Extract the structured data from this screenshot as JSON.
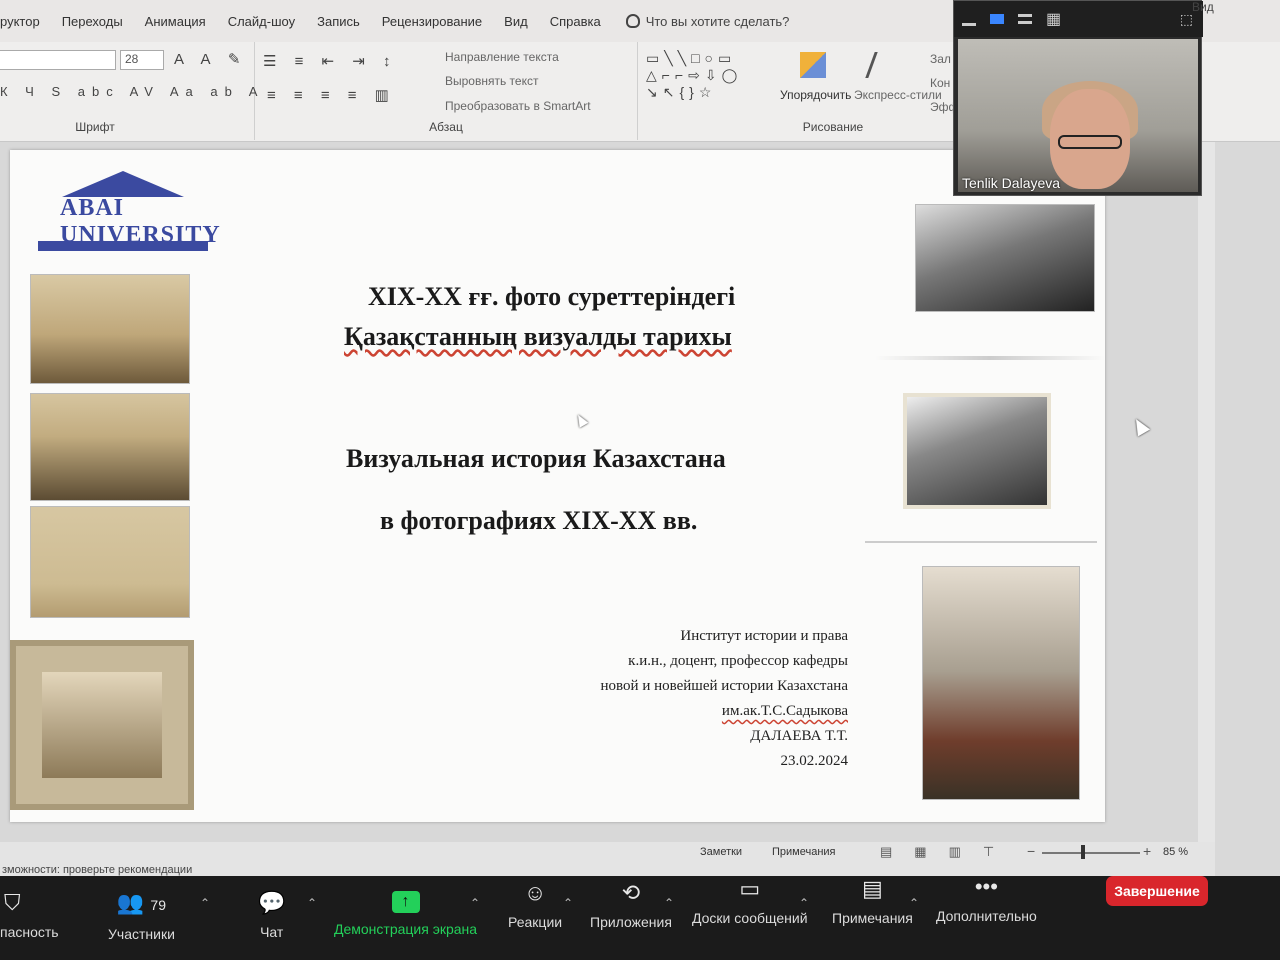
{
  "menu": {
    "items": [
      "руктор",
      "Переходы",
      "Анимация",
      "Слайд-шоу",
      "Запись",
      "Рецензирование",
      "Вид",
      "Справка"
    ],
    "tell_me": "Что вы хотите сделать?"
  },
  "ribbon": {
    "font_size": "28",
    "group_font": "Шрифт",
    "group_paragraph": "Абзац",
    "group_drawing": "Рисование",
    "text_direction": "Направление текста",
    "align_text": "Выровнять текст",
    "convert_smartart": "Преобразовать в SmartArt",
    "arrange": "Упорядочить",
    "quick_styles": "Экспресс-стили",
    "fill_1": "Зал",
    "fill_2": "Кон",
    "fill_3": "Эфф"
  },
  "video": {
    "participant_name": "Tenlik Dalayeva",
    "top_label": "Вид"
  },
  "slide": {
    "logo_text": "ABAI UNIVERSITY",
    "title_kk_line1": "XIX-XX ғғ. фото суреттеріндегі",
    "title_kk_line2": "Қазақстанның визуалды тарихы",
    "title_ru_line1": "Визуальная история Казахстана",
    "title_ru_line2": "в фотографиях XIX-XX вв.",
    "author_lines": [
      "Институт истории и права",
      "к.и.н., доцент, профессор кафедры",
      "новой и новейшей истории Казахстана",
      "им.ак.Т.С.Садыкова",
      "ДАЛАЕВА Т.Т.",
      "23.02.2024"
    ]
  },
  "status": {
    "notes": "Заметки",
    "comments": "Примечания",
    "zoom": "85 %",
    "accessibility_hint": "зможности: проверьте рекомендации"
  },
  "zoom_toolbar": {
    "security": "пасность",
    "participants": "Участники",
    "participants_count": "79",
    "chat": "Чат",
    "share_screen": "Демонстрация экрана",
    "reactions": "Реакции",
    "apps": "Приложения",
    "whiteboards": "Доски сообщений",
    "notes": "Примечания",
    "more": "Дополнительно",
    "end": "Завершение"
  },
  "colors": {
    "share_green": "#23d05a",
    "end_red": "#d9262c",
    "logo_blue": "#3b4aa0"
  }
}
